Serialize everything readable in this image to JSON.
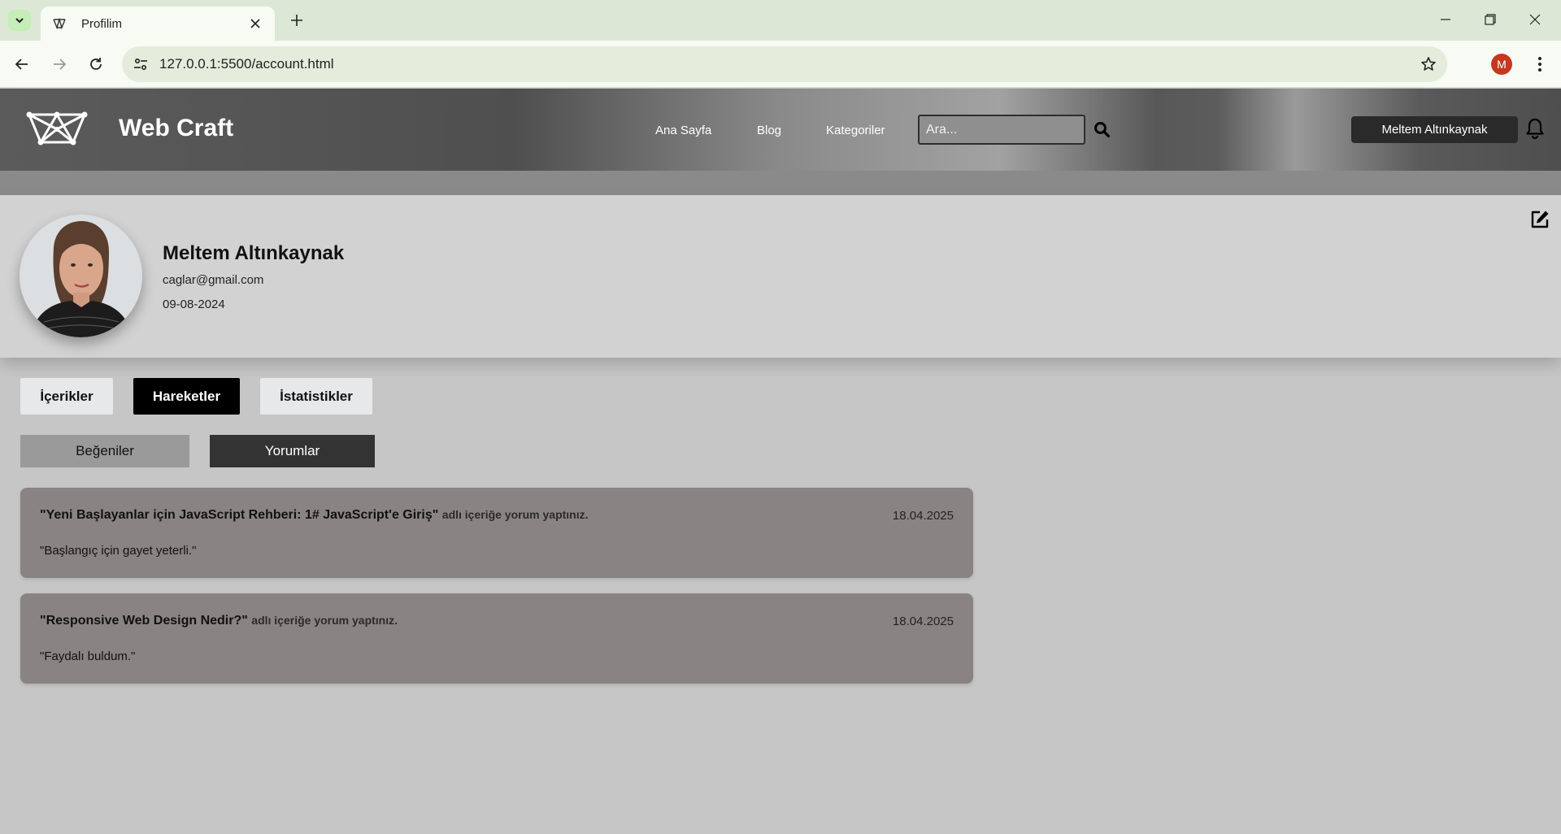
{
  "browser": {
    "tab_title": "Profilim",
    "url": "127.0.0.1:5500/account.html",
    "profile_initial": "M"
  },
  "header": {
    "brand": "Web Craft",
    "nav": [
      "Ana Sayfa",
      "Blog",
      "Kategoriler"
    ],
    "search_placeholder": "Ara...",
    "user_button": "Meltem Altınkaynak"
  },
  "profile": {
    "name": "Meltem Altınkaynak",
    "email": "caglar@gmail.com",
    "date": "09-08-2024"
  },
  "tabs": [
    {
      "label": "İçerikler",
      "active": false
    },
    {
      "label": "Hareketler",
      "active": true
    },
    {
      "label": "İstatistikler",
      "active": false
    }
  ],
  "subtabs": [
    {
      "label": "Beğeniler",
      "active": false
    },
    {
      "label": "Yorumlar",
      "active": true
    }
  ],
  "comments": [
    {
      "title": "\"Yeni Başlayanlar için JavaScript Rehberi: 1# JavaScript'e Giriş\"",
      "suffix": "adlı içeriğe yorum yaptınız.",
      "date": "18.04.2025",
      "text": "\"Başlangıç için gayet yeterli.\""
    },
    {
      "title": "\"Responsive Web Design Nedir?\"",
      "suffix": "adlı içeriğe yorum yaptınız.",
      "date": "18.04.2025",
      "text": "\"Faydalı buldum.\""
    }
  ],
  "colors": {
    "header_dark": "#4f4f4f",
    "profile_bg": "#d2d2d2",
    "page_bg": "#c6c6c6",
    "comment_card": "#898483",
    "active_tab": "#000000",
    "active_subtab": "#333333"
  },
  "icons": {
    "search": "search-icon",
    "notifications": "bell-icon",
    "edit_profile": "edit-icon"
  }
}
